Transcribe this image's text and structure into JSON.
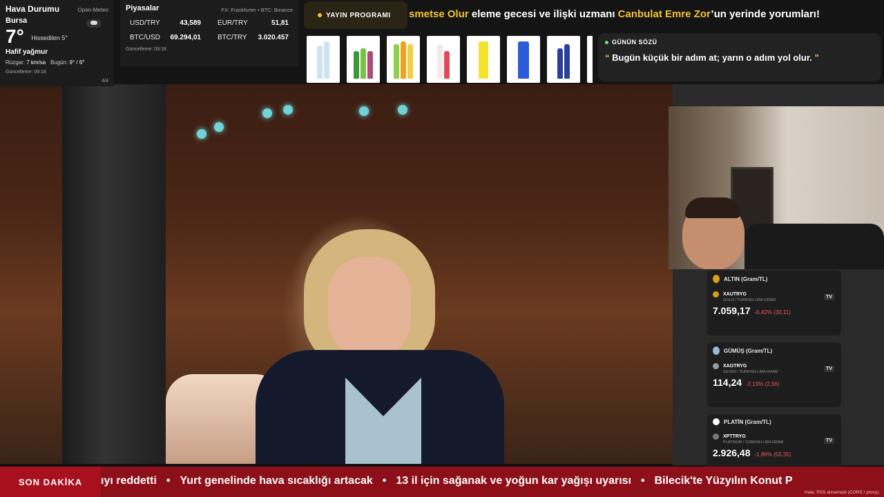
{
  "weather": {
    "title": "Hava Durumu",
    "source": "Open-Meteo",
    "city": "Bursa",
    "temp": "7°",
    "feels": "Hissedilen 5°",
    "desc": "Hafif yağmur",
    "wind_label": "Rüzgar:",
    "wind": "7 km/sa",
    "today_label": "Bugün:",
    "today": "9° / 6°",
    "updated": "Güncelleme: 09:18",
    "page": "4/4",
    "icon": "cloud-icon"
  },
  "markets": {
    "title": "Piyasalar",
    "source": "FX: Frankfurter • BTC: Binance",
    "rows": [
      {
        "label": "USD/TRY",
        "value": "43,589"
      },
      {
        "label": "EUR/TRY",
        "value": "51,81"
      },
      {
        "label": "BTC/USD",
        "value": "69.294,01"
      },
      {
        "label": "BTC/TRY",
        "value": "3.020.457"
      }
    ],
    "updated": "Güncelleme: 09:18"
  },
  "schedule": {
    "label": "YAYIN PROGRAMI",
    "text_a": "smetse Olur",
    "text_b": " eleme gecesi ve ilişki uzmanı ",
    "text_c": "Canbulat Emre Zor",
    "text_d": "’un yerinde yorumları!"
  },
  "quote": {
    "title": "GÜNÜN SÖZÜ",
    "open_mark": "“",
    "text": " Bugün küçük bir adım at; yarın o adım yol olur. ",
    "close_mark": "”"
  },
  "metals": [
    {
      "title": "ALTIN (Gram/TL)",
      "symbol": "XAUTRYG",
      "sub": "GOLD / TURKISH LIRA GRAM",
      "price": "7.059,17",
      "change": "-0,42% (30,11)",
      "color": "#d6a01e"
    },
    {
      "title": "GÜMÜŞ (Gram/TL)",
      "symbol": "XAGTRYG",
      "sub": "SILVER / TURKISH LIRA GRAM",
      "price": "114,24",
      "change": "-2,19% (2,56)",
      "color": "#9fb8d8"
    },
    {
      "title": "PLATİN (Gram/TL)",
      "symbol": "XPTTRYG",
      "sub": "PLATINUM / TURKISH LIRA GRAM",
      "price": "2.926,48",
      "change": "-1,86% (55,35)",
      "color": "#ffffff"
    }
  ],
  "metals_tv": "TV",
  "ticker": {
    "label": "SON DAKİKA",
    "items": [
      "ıyı reddetti",
      "Yurt genelinde hava sıcaklığı artacak",
      "13 il için sağanak ve yoğun kar yağışı uyarısı",
      "Bilecik'te Yüzyılın Konut P"
    ],
    "separator": "•",
    "note": "Hata: RSS alınamadı (CORS / proxy)."
  }
}
